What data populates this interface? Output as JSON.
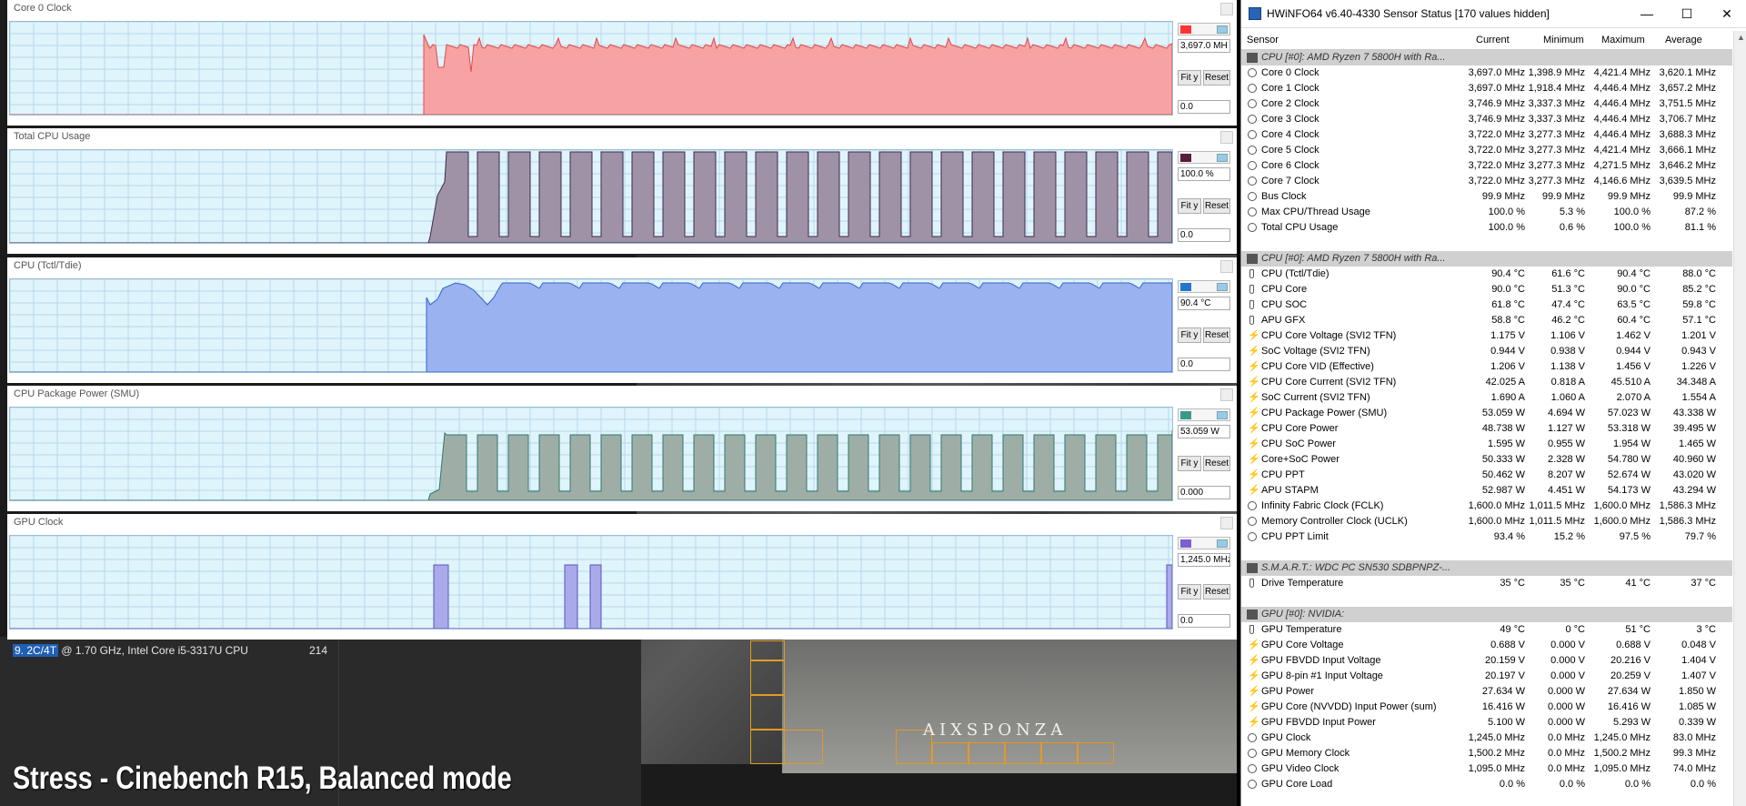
{
  "graphs": [
    {
      "title": "Core 0 Clock",
      "value": "3,697.0 MH",
      "min": "0.0",
      "color": "#ff3333",
      "fill": "#f7a3a3",
      "stroke": "#e0484a",
      "kind": "clock",
      "fit": "Fit y",
      "reset": "Reset"
    },
    {
      "title": "Total CPU Usage",
      "value": "100.0 %",
      "min": "0.0",
      "color": "#5a1a3a",
      "fill": "#a092a6",
      "stroke": "#3a2a50",
      "kind": "usage",
      "fit": "Fit y",
      "reset": "Reset"
    },
    {
      "title": "CPU (Tctl/Tdie)",
      "value": "90.4 °C",
      "min": "0.0",
      "color": "#2277cc",
      "fill": "#9ab2f0",
      "stroke": "#2f66c8",
      "kind": "temp",
      "fit": "Fit y",
      "reset": "Reset"
    },
    {
      "title": "CPU Package Power (SMU)",
      "value": "53.059 W",
      "min": "0.000",
      "color": "#3a9a8a",
      "fill": "#9eaea6",
      "stroke": "#2f7a6a",
      "kind": "power",
      "fit": "Fit y",
      "reset": "Reset"
    },
    {
      "title": "GPU Clock",
      "value": "1,245.0 MHz",
      "min": "0.0",
      "color": "#7a60d0",
      "fill": "#aaaaea",
      "stroke": "#5a54c0",
      "kind": "gpu",
      "fit": "Fit y",
      "reset": "Reset"
    }
  ],
  "cinebench": {
    "row_rank": "9. 2C/4T",
    "row_desc": " @ 1.70 GHz,  Intel Core i5-3317U CPU",
    "row_score": "214",
    "logo": "AIXSPONZA"
  },
  "caption": "Stress - Cinebench R15, Balanced mode",
  "hwinfo": {
    "title": "HWiNFO64 v6.40-4330 Sensor Status [170 values hidden]",
    "columns": {
      "sensor": "Sensor",
      "current": "Current",
      "minimum": "Minimum",
      "maximum": "Maximum",
      "average": "Average"
    },
    "rows": [
      {
        "type": "group",
        "name": "CPU [#0]: AMD Ryzen 7 5800H with Ra..."
      },
      {
        "type": "item",
        "icon": "clock",
        "name": "Core 0 Clock",
        "cur": "3,697.0 MHz",
        "min": "1,398.9 MHz",
        "max": "4,421.4 MHz",
        "avg": "3,620.1 MHz"
      },
      {
        "type": "item",
        "icon": "clock",
        "name": "Core 1 Clock",
        "cur": "3,697.0 MHz",
        "min": "1,918.4 MHz",
        "max": "4,446.4 MHz",
        "avg": "3,657.2 MHz"
      },
      {
        "type": "item",
        "icon": "clock",
        "name": "Core 2 Clock",
        "cur": "3,746.9 MHz",
        "min": "3,337.3 MHz",
        "max": "4,446.4 MHz",
        "avg": "3,751.5 MHz"
      },
      {
        "type": "item",
        "icon": "clock",
        "name": "Core 3 Clock",
        "cur": "3,746.9 MHz",
        "min": "3,337.3 MHz",
        "max": "4,446.4 MHz",
        "avg": "3,706.7 MHz"
      },
      {
        "type": "item",
        "icon": "clock",
        "name": "Core 4 Clock",
        "cur": "3,722.0 MHz",
        "min": "3,277.3 MHz",
        "max": "4,446.4 MHz",
        "avg": "3,688.3 MHz"
      },
      {
        "type": "item",
        "icon": "clock",
        "name": "Core 5 Clock",
        "cur": "3,722.0 MHz",
        "min": "3,277.3 MHz",
        "max": "4,421.4 MHz",
        "avg": "3,666.1 MHz"
      },
      {
        "type": "item",
        "icon": "clock",
        "name": "Core 6 Clock",
        "cur": "3,722.0 MHz",
        "min": "3,277.3 MHz",
        "max": "4,271.5 MHz",
        "avg": "3,646.2 MHz"
      },
      {
        "type": "item",
        "icon": "clock",
        "name": "Core 7 Clock",
        "cur": "3,722.0 MHz",
        "min": "3,277.3 MHz",
        "max": "4,146.6 MHz",
        "avg": "3,639.5 MHz"
      },
      {
        "type": "item",
        "icon": "clock",
        "name": "Bus Clock",
        "cur": "99.9 MHz",
        "min": "99.9 MHz",
        "max": "99.9 MHz",
        "avg": "99.9 MHz"
      },
      {
        "type": "item",
        "icon": "pct",
        "name": "Max CPU/Thread Usage",
        "cur": "100.0 %",
        "min": "5.3 %",
        "max": "100.0 %",
        "avg": "87.2 %"
      },
      {
        "type": "item",
        "icon": "pct",
        "name": "Total CPU Usage",
        "cur": "100.0 %",
        "min": "0.6 %",
        "max": "100.0 %",
        "avg": "81.1 %"
      },
      {
        "type": "blank"
      },
      {
        "type": "group",
        "name": "CPU [#0]: AMD Ryzen 7 5800H with Ra..."
      },
      {
        "type": "item",
        "icon": "temp",
        "name": "CPU (Tctl/Tdie)",
        "cur": "90.4 °C",
        "min": "61.6 °C",
        "max": "90.4 °C",
        "avg": "88.0 °C"
      },
      {
        "type": "item",
        "icon": "temp",
        "name": "CPU Core",
        "cur": "90.0 °C",
        "min": "51.3 °C",
        "max": "90.0 °C",
        "avg": "85.2 °C"
      },
      {
        "type": "item",
        "icon": "temp",
        "name": "CPU SOC",
        "cur": "61.8 °C",
        "min": "47.4 °C",
        "max": "63.5 °C",
        "avg": "59.8 °C"
      },
      {
        "type": "item",
        "icon": "temp",
        "name": "APU GFX",
        "cur": "58.8 °C",
        "min": "46.2 °C",
        "max": "60.4 °C",
        "avg": "57.1 °C"
      },
      {
        "type": "item",
        "icon": "volt",
        "name": "CPU Core Voltage (SVI2 TFN)",
        "cur": "1.175 V",
        "min": "1.106 V",
        "max": "1.462 V",
        "avg": "1.201 V"
      },
      {
        "type": "item",
        "icon": "volt",
        "name": "SoC Voltage (SVI2 TFN)",
        "cur": "0.944 V",
        "min": "0.938 V",
        "max": "0.944 V",
        "avg": "0.943 V"
      },
      {
        "type": "item",
        "icon": "volt",
        "name": "CPU Core VID (Effective)",
        "cur": "1.206 V",
        "min": "1.138 V",
        "max": "1.456 V",
        "avg": "1.226 V"
      },
      {
        "type": "item",
        "icon": "volt",
        "name": "CPU Core Current (SVI2 TFN)",
        "cur": "42.025 A",
        "min": "0.818 A",
        "max": "45.510 A",
        "avg": "34.348 A"
      },
      {
        "type": "item",
        "icon": "volt",
        "name": "SoC Current (SVI2 TFN)",
        "cur": "1.690 A",
        "min": "1.060 A",
        "max": "2.070 A",
        "avg": "1.554 A"
      },
      {
        "type": "item",
        "icon": "volt",
        "name": "CPU Package Power (SMU)",
        "cur": "53.059 W",
        "min": "4.694 W",
        "max": "57.023 W",
        "avg": "43.338 W"
      },
      {
        "type": "item",
        "icon": "volt",
        "name": "CPU Core Power",
        "cur": "48.738 W",
        "min": "1.127 W",
        "max": "53.318 W",
        "avg": "39.495 W"
      },
      {
        "type": "item",
        "icon": "volt",
        "name": "CPU SoC Power",
        "cur": "1.595 W",
        "min": "0.955 W",
        "max": "1.954 W",
        "avg": "1.465 W"
      },
      {
        "type": "item",
        "icon": "volt",
        "name": "Core+SoC Power",
        "cur": "50.333 W",
        "min": "2.328 W",
        "max": "54.780 W",
        "avg": "40.960 W"
      },
      {
        "type": "item",
        "icon": "volt",
        "name": "CPU PPT",
        "cur": "50.462 W",
        "min": "8.207 W",
        "max": "52.674 W",
        "avg": "43.020 W"
      },
      {
        "type": "item",
        "icon": "volt",
        "name": "APU STAPM",
        "cur": "52.987 W",
        "min": "4.451 W",
        "max": "54.173 W",
        "avg": "43.294 W"
      },
      {
        "type": "item",
        "icon": "clock",
        "name": "Infinity Fabric Clock (FCLK)",
        "cur": "1,600.0 MHz",
        "min": "1,011.5 MHz",
        "max": "1,600.0 MHz",
        "avg": "1,586.3 MHz"
      },
      {
        "type": "item",
        "icon": "clock",
        "name": "Memory Controller Clock (UCLK)",
        "cur": "1,600.0 MHz",
        "min": "1,011.5 MHz",
        "max": "1,600.0 MHz",
        "avg": "1,586.3 MHz"
      },
      {
        "type": "item",
        "icon": "pct",
        "name": "CPU PPT Limit",
        "cur": "93.4 %",
        "min": "15.2 %",
        "max": "97.5 %",
        "avg": "79.7 %"
      },
      {
        "type": "blank"
      },
      {
        "type": "group",
        "name": "S.M.A.R.T.: WDC PC SN530 SDBPNPZ-..."
      },
      {
        "type": "item",
        "icon": "temp",
        "name": "Drive Temperature",
        "cur": "35 °C",
        "min": "35 °C",
        "max": "41 °C",
        "avg": "37 °C"
      },
      {
        "type": "blank"
      },
      {
        "type": "group",
        "name": "GPU [#0]: NVIDIA:"
      },
      {
        "type": "item",
        "icon": "temp",
        "name": "GPU Temperature",
        "cur": "49 °C",
        "min": "0 °C",
        "max": "51 °C",
        "avg": "3 °C"
      },
      {
        "type": "item",
        "icon": "volt",
        "name": "GPU Core Voltage",
        "cur": "0.688 V",
        "min": "0.000 V",
        "max": "0.688 V",
        "avg": "0.048 V"
      },
      {
        "type": "item",
        "icon": "volt",
        "name": "GPU FBVDD Input Voltage",
        "cur": "20.159 V",
        "min": "0.000 V",
        "max": "20.216 V",
        "avg": "1.404 V"
      },
      {
        "type": "item",
        "icon": "volt",
        "name": "GPU 8-pin #1 Input Voltage",
        "cur": "20.197 V",
        "min": "0.000 V",
        "max": "20.259 V",
        "avg": "1.407 V"
      },
      {
        "type": "item",
        "icon": "volt",
        "name": "GPU Power",
        "cur": "27.634 W",
        "min": "0.000 W",
        "max": "27.634 W",
        "avg": "1.850 W"
      },
      {
        "type": "item",
        "icon": "volt",
        "name": "GPU Core (NVVDD) Input Power (sum)",
        "cur": "16.416 W",
        "min": "0.000 W",
        "max": "16.416 W",
        "avg": "1.085 W"
      },
      {
        "type": "item",
        "icon": "volt",
        "name": "GPU FBVDD Input Power",
        "cur": "5.100 W",
        "min": "0.000 W",
        "max": "5.293 W",
        "avg": "0.339 W"
      },
      {
        "type": "item",
        "icon": "clock",
        "name": "GPU Clock",
        "cur": "1,245.0 MHz",
        "min": "0.0 MHz",
        "max": "1,245.0 MHz",
        "avg": "83.0 MHz"
      },
      {
        "type": "item",
        "icon": "clock",
        "name": "GPU Memory Clock",
        "cur": "1,500.2 MHz",
        "min": "0.0 MHz",
        "max": "1,500.2 MHz",
        "avg": "99.3 MHz"
      },
      {
        "type": "item",
        "icon": "clock",
        "name": "GPU Video Clock",
        "cur": "1,095.0 MHz",
        "min": "0.0 MHz",
        "max": "1,095.0 MHz",
        "avg": "74.0 MHz"
      },
      {
        "type": "item",
        "icon": "pct",
        "name": "GPU Core Load",
        "cur": "0.0 %",
        "min": "0.0 %",
        "max": "0.0 %",
        "avg": "0.0 %"
      }
    ]
  }
}
